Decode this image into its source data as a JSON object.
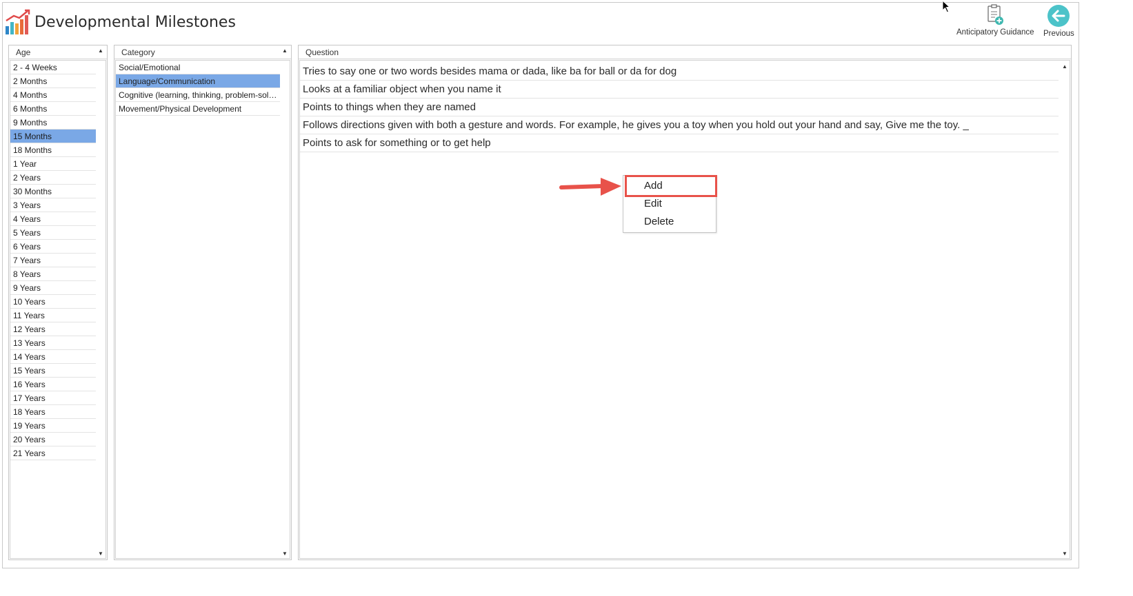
{
  "app": {
    "title": "Developmental Milestones"
  },
  "toolbar": {
    "anticipatory_label": "Anticipatory Guidance",
    "previous_label": "Previous"
  },
  "age_panel": {
    "header": "Age",
    "selected_index": 5,
    "items": [
      "2 - 4 Weeks",
      "2 Months",
      "4 Months",
      "6 Months",
      "9 Months",
      "15 Months",
      "18 Months",
      "1 Year",
      "2 Years",
      "30 Months",
      "3 Years",
      "4 Years",
      "5 Years",
      "6 Years",
      "7 Years",
      "8 Years",
      "9 Years",
      "10 Years",
      "11 Years",
      "12 Years",
      "13 Years",
      "14 Years",
      "15 Years",
      "16 Years",
      "17 Years",
      "18 Years",
      "19 Years",
      "20 Years",
      "21 Years"
    ]
  },
  "category_panel": {
    "header": "Category",
    "selected_index": 1,
    "items": [
      "Social/Emotional",
      "Language/Communication",
      "Cognitive (learning, thinking, problem-solvi...",
      "Movement/Physical Development"
    ]
  },
  "question_panel": {
    "header": "Question",
    "items": [
      "Tries to say one or two words besides mama or dada, like ba for ball or da for dog",
      "Looks at a familiar object when you name it",
      "Points to things when they are named",
      "Follows directions given with both a gesture and words. For example, he gives you a toy when you hold out your hand and say, Give me the toy. _",
      "Points to ask for something or to get help"
    ]
  },
  "context_menu": {
    "add": "Add",
    "edit": "Edit",
    "delete": "Delete"
  },
  "colors": {
    "selection": "#7aa8e6",
    "highlight": "#e8524a",
    "previous_button": "#4cc3c9"
  }
}
